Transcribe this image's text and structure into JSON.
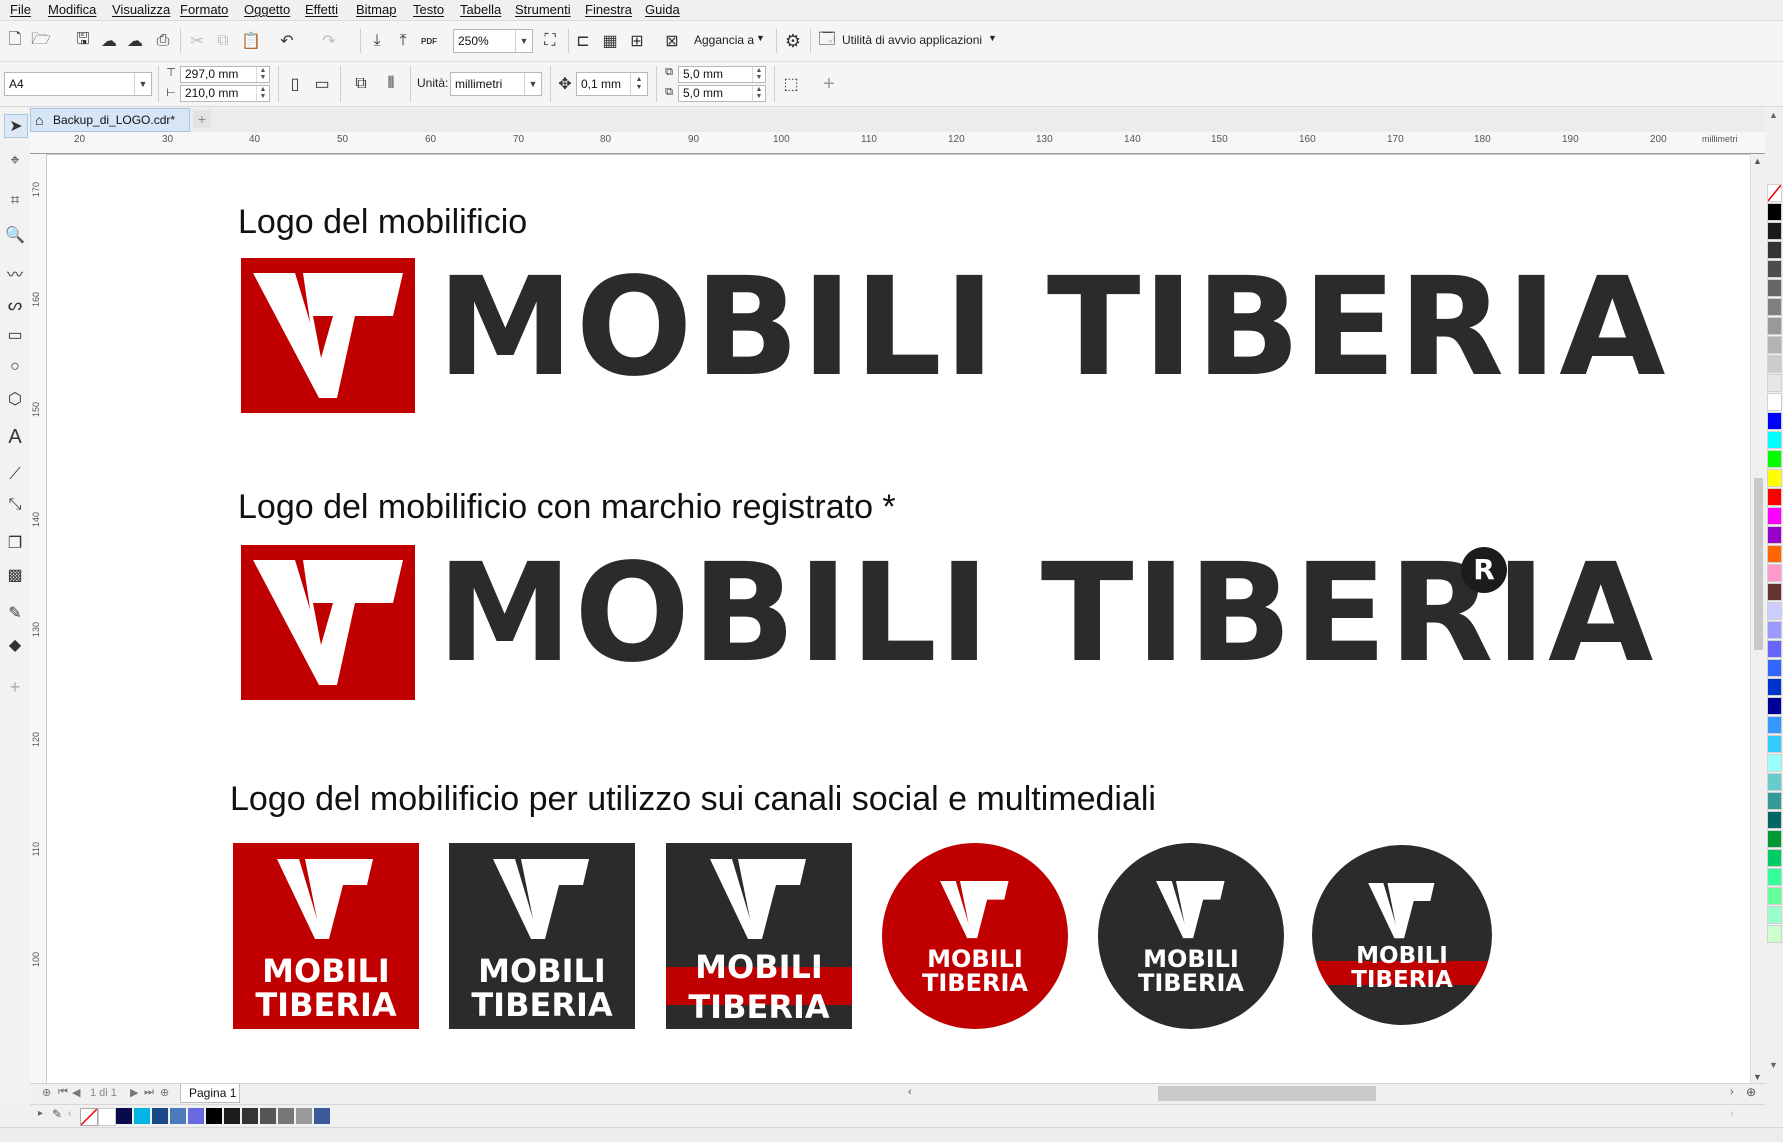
{
  "menu": {
    "items": [
      "File",
      "Modifica",
      "Visualizza",
      "Formato",
      "Oggetto",
      "Effetti",
      "Bitmap",
      "Testo",
      "Tabella",
      "Strumenti",
      "Finestra",
      "Guida"
    ]
  },
  "toolbar": {
    "zoom": "250%",
    "snap_label": "Aggancia a",
    "launcher_label": "Utilità di avvio applicazioni",
    "pdf_label": "PDF"
  },
  "propertybar": {
    "page_size": "A4",
    "width": "297,0 mm",
    "height": "210,0 mm",
    "units_label": "Unità:",
    "units_value": "millimetri",
    "nudge": "0,1 mm",
    "dup_x": "5,0 mm",
    "dup_y": "5,0 mm"
  },
  "tabs": {
    "document": "Backup_di_LOGO.cdr*"
  },
  "ruler": {
    "h_labels": [
      "20",
      "30",
      "40",
      "50",
      "60",
      "70",
      "80",
      "90",
      "100",
      "110",
      "120",
      "130",
      "140",
      "150",
      "160",
      "170",
      "180",
      "190",
      "200"
    ],
    "unit": "millimetri",
    "v_labels": [
      "170",
      "160",
      "150",
      "140",
      "130",
      "120",
      "110",
      "100"
    ]
  },
  "canvas": {
    "heading1": "Logo del mobilificio",
    "heading2": "Logo del mobilificio con marchio registrato *",
    "heading3": "Logo del mobilificio per utilizzo sui canali social e multimediali",
    "wordmark": "MOBILI TIBERIA",
    "registered_symbol": "R",
    "badge_line1": "MOBILI",
    "badge_line2": "TIBERIA"
  },
  "colors": {
    "brand_red": "#c00000",
    "brand_dark": "#2b2b2b",
    "text_dark": "#111111"
  },
  "pagenav": {
    "page_info": "1 di 1",
    "page_tab": "Pagina 1"
  }
}
